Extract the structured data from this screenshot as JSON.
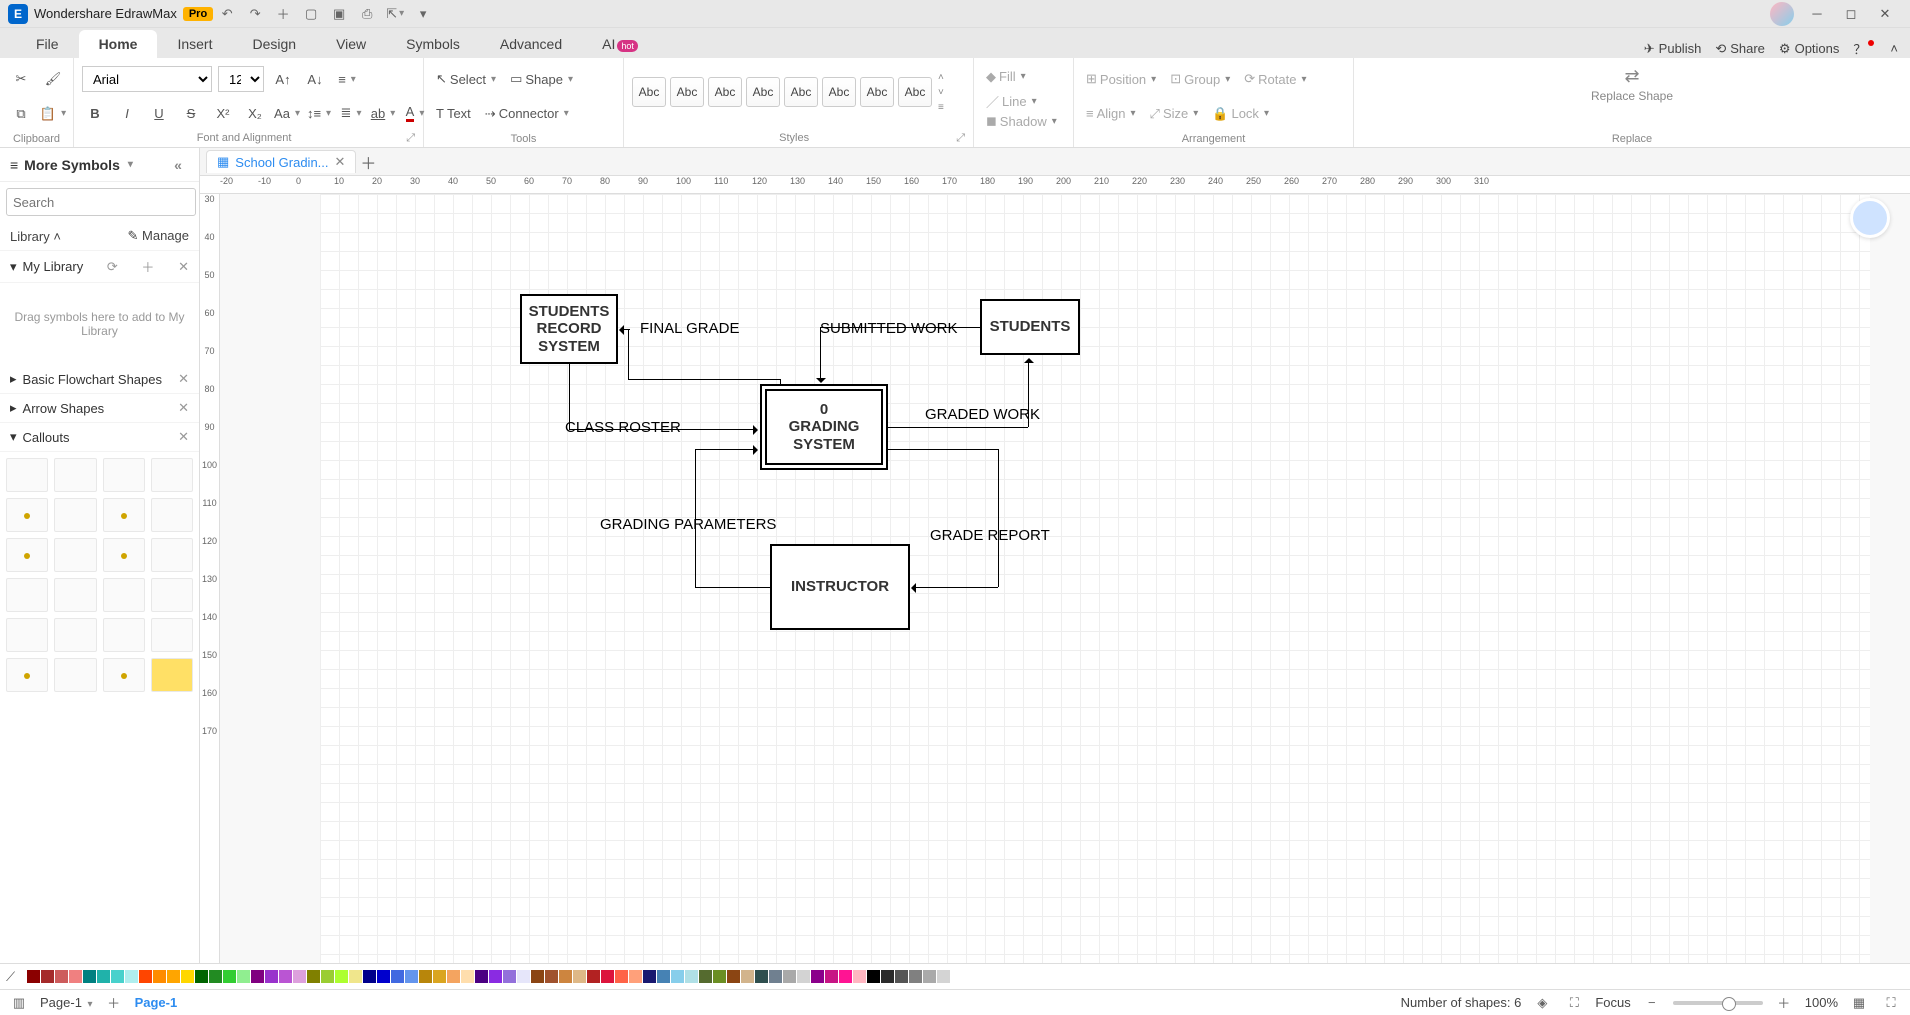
{
  "app": {
    "name": "Wondershare EdrawMax",
    "badge": "Pro"
  },
  "menu": {
    "tabs": [
      "File",
      "Home",
      "Insert",
      "Design",
      "View",
      "Symbols",
      "Advanced",
      "AI"
    ],
    "active": 1,
    "ai_badge": "hot",
    "right": {
      "publish": "Publish",
      "share": "Share",
      "options": "Options"
    }
  },
  "ribbon": {
    "font": {
      "name": "Arial",
      "size": "12"
    },
    "tools": {
      "select": "Select",
      "text": "Text",
      "shape": "Shape",
      "connector": "Connector"
    },
    "style_label": "Abc",
    "format": {
      "fill": "Fill",
      "line": "Line",
      "shadow": "Shadow"
    },
    "arrange": {
      "position": "Position",
      "align": "Align",
      "group": "Group",
      "size": "Size",
      "rotate": "Rotate",
      "lock": "Lock"
    },
    "replace": "Replace Shape",
    "groups": {
      "clipboard": "Clipboard",
      "font": "Font and Alignment",
      "tools": "Tools",
      "styles": "Styles",
      "arrangement": "Arrangement",
      "replace": "Replace"
    }
  },
  "sidebar": {
    "title": "More Symbols",
    "search_placeholder": "Search",
    "search_btn": "Search",
    "library": "Library",
    "manage": "Manage",
    "mylib": "My Library",
    "dropzone": "Drag symbols here to add to My Library",
    "sections": [
      "Basic Flowchart Shapes",
      "Arrow Shapes",
      "Callouts"
    ]
  },
  "doc": {
    "tab": "School Gradin...",
    "page": "Page-1"
  },
  "ruler_h": [
    "-20",
    "-10",
    "0",
    "10",
    "20",
    "30",
    "40",
    "50",
    "60",
    "70",
    "80",
    "90",
    "100",
    "110",
    "120",
    "130",
    "140",
    "150",
    "160",
    "170",
    "180",
    "190",
    "200",
    "210",
    "220",
    "230",
    "240",
    "250",
    "260",
    "270",
    "280",
    "290",
    "300",
    "310"
  ],
  "ruler_v": [
    "30",
    "40",
    "50",
    "60",
    "70",
    "80",
    "90",
    "100",
    "110",
    "120",
    "130",
    "140",
    "150",
    "160",
    "170"
  ],
  "diagram": {
    "srs": "STUDENTS RECORD SYSTEM",
    "students": "STUDENTS",
    "grading": "0\nGRADING SYSTEM",
    "instructor": "INSTRUCTOR",
    "final_grade": "FINAL GRADE",
    "submitted_work": "SUBMITTED WORK",
    "class_roster": "CLASS ROSTER",
    "graded_work": "GRADED WORK",
    "grading_params": "GRADING PARAMETERS",
    "grade_report": "GRADE REPORT"
  },
  "status": {
    "page_sel": "Page-1",
    "shapes": "Number of shapes: 6",
    "focus": "Focus",
    "zoom": "100%"
  }
}
